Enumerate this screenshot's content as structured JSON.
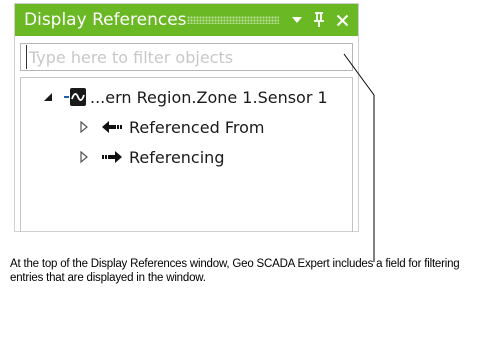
{
  "window": {
    "title": "Display References",
    "dropdown_icon": "chevron-down-icon",
    "pin_icon": "pin-icon",
    "close_icon": "close-icon",
    "accent_color": "#6ab823"
  },
  "filter": {
    "value": "",
    "placeholder": "Type here to filter objects"
  },
  "tree": {
    "root": {
      "label": "...ern Region.Zone 1.Sensor 1",
      "expanded": true,
      "icon": "analog-point-icon"
    },
    "children": [
      {
        "label": "Referenced From",
        "expanded": false,
        "icon": "arrow-left-icon"
      },
      {
        "label": "Referencing",
        "expanded": false,
        "icon": "arrow-right-icon"
      }
    ]
  },
  "caption": {
    "text": "At the top of the Display References window, Geo SCADA Expert includes a field for filtering entries that are displayed in the window."
  }
}
